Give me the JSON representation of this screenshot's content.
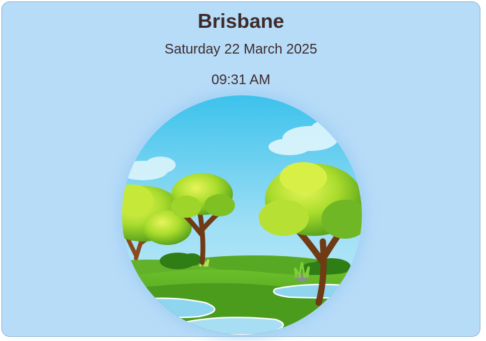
{
  "widget": {
    "city": "Brisbane",
    "date": "Saturday 22 March 2025",
    "time": "09:31 AM",
    "illustration": "daytime-park-scene",
    "colors": {
      "card_background": "#b7dcf8",
      "text": "#3d2b2b",
      "sky": "#4fc9ee",
      "grass": "#4b9b1d"
    }
  }
}
